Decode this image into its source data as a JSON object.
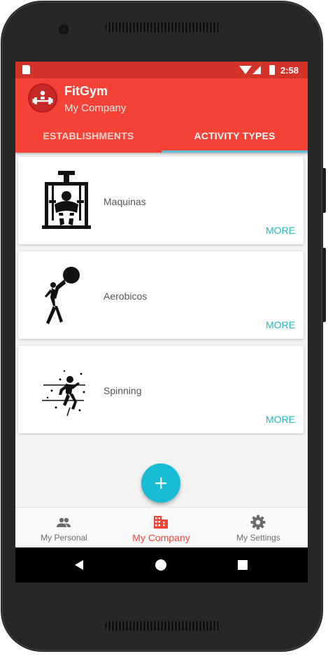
{
  "status_bar": {
    "time": "2:58"
  },
  "app_bar": {
    "title": "FitGym",
    "subtitle": "My Company"
  },
  "tabs": [
    {
      "label": "ESTABLISHMENTS",
      "active": false
    },
    {
      "label": "ACTIVITY TYPES",
      "active": true
    }
  ],
  "cards": [
    {
      "name": "Maquinas",
      "action": "MORE",
      "icon": "gym-machine-icon"
    },
    {
      "name": "Aerobicos",
      "action": "MORE",
      "icon": "aerobics-icon"
    },
    {
      "name": "Spinning",
      "action": "MORE",
      "icon": "spinning-icon"
    }
  ],
  "fab": {
    "icon": "plus-icon"
  },
  "bottom_nav": [
    {
      "label": "My Personal",
      "icon": "people-icon",
      "active": false
    },
    {
      "label": "My Company",
      "icon": "building-icon",
      "active": true
    },
    {
      "label": "My Settings",
      "icon": "gear-icon",
      "active": false
    }
  ],
  "colors": {
    "primary": "#f44336",
    "primary_dark": "#d4332a",
    "accent": "#18bcd5",
    "more_link": "#26b5c9",
    "tab_indicator": "#5bc0de"
  }
}
